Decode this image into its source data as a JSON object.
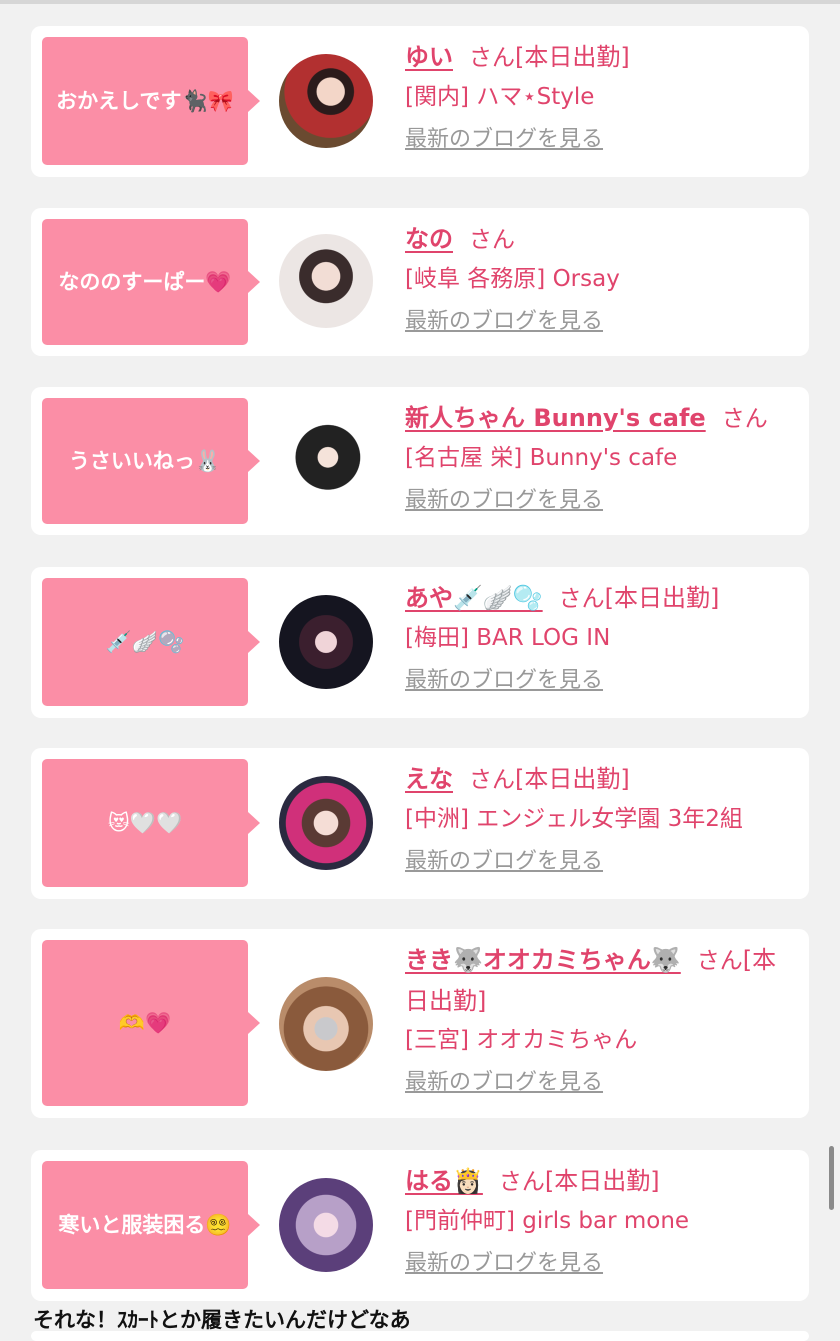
{
  "cards": [
    {
      "bubble": "おかえしです🐈‍⬛🎀",
      "name": "ゆい",
      "san": "さん",
      "status": "[本日出勤]",
      "shop": "[関内] ハマ⋆Style",
      "blog": "最新のブログを見る"
    },
    {
      "bubble": "なののすーぱー💗",
      "name": "なの",
      "san": "さん",
      "status": "",
      "shop": "[岐阜 各務原] Orsay",
      "blog": "最新のブログを見る"
    },
    {
      "bubble": "うさいいねっ🐰",
      "name": "新人ちゃん Bunny's cafe",
      "san": "さん",
      "status": "",
      "shop": "[名古屋 栄] Bunny's cafe",
      "blog": "最新のブログを見る"
    },
    {
      "bubble": "💉🪽🫧",
      "name": "あや💉🪽🫧",
      "san": "さん",
      "status": "[本日出勤]",
      "shop": "[梅田] BAR LOG IN",
      "blog": "最新のブログを見る"
    },
    {
      "bubble": "😻🤍🤍",
      "name": "えな",
      "san": "さん",
      "status": "[本日出勤]",
      "shop": "[中洲] エンジェル女学園 3年2組",
      "blog": "最新のブログを見る"
    },
    {
      "bubble": "🫶💗",
      "name": "きき🐺オオカミちゃん🐺",
      "san": "さん",
      "status": "[本日出勤]",
      "shop": "[三宮] オオカミちゃん",
      "blog": "最新のブログを見る"
    },
    {
      "bubble": "寒いと服装困る😵‍💫",
      "name": "はる👸🏻",
      "san": "さん",
      "status": "[本日出勤]",
      "shop": "[門前仲町] girls bar mone",
      "blog": "最新のブログを見る"
    }
  ],
  "footer_text": "それな！ｽｶｰﾄとか履きたいんだけどなあ",
  "colors": {
    "accent": "#e0446c",
    "bubble": "#fb8ea6"
  }
}
